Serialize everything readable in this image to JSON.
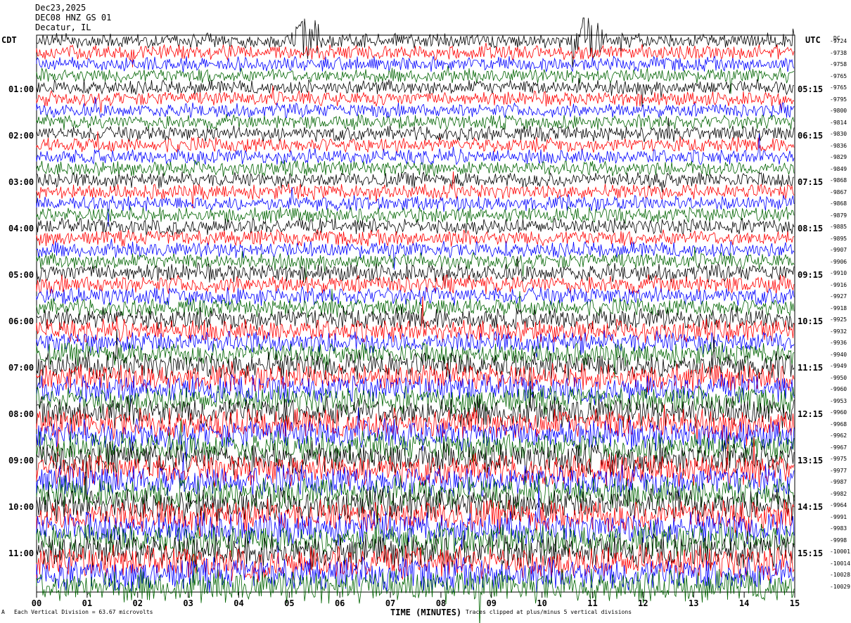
{
  "header": {
    "date": "Dec23,2025",
    "station": "DEC08 HNZ GS 01",
    "location": "Decatur, IL"
  },
  "left_timezone": "CDT",
  "right_timezone": "UTC",
  "dc_header": "DC",
  "footer": {
    "scale_note": "Each Vertical Division = 63.67 microvolts",
    "clip_note": "Traces clipped at plus/minus 5 vertical divisions",
    "corner_mark": "A"
  },
  "chart_data": {
    "type": "line",
    "title": "DEC08 HNZ GS 01",
    "xlabel": "TIME (MINUTES)",
    "ylabel": "",
    "xlim": [
      0,
      15
    ],
    "x_ticks": [
      "00",
      "01",
      "02",
      "03",
      "04",
      "05",
      "06",
      "07",
      "08",
      "09",
      "10",
      "11",
      "12",
      "13",
      "14",
      "15"
    ],
    "left_hour_labels": [
      "01:00",
      "02:00",
      "03:00",
      "04:00",
      "05:00",
      "06:00",
      "07:00",
      "08:00",
      "09:00",
      "10:00",
      "11:00"
    ],
    "right_hour_labels": [
      "05:15",
      "06:15",
      "07:15",
      "08:15",
      "09:15",
      "10:15",
      "11:15",
      "12:15",
      "13:15",
      "14:15",
      "15:15"
    ],
    "trace_colors": [
      "#000000",
      "#ff0000",
      "#0000ff",
      "#006400"
    ],
    "dc_offsets": [
      "-9724",
      "-9738",
      "-9758",
      "-9765",
      "-9765",
      "-9795",
      "-9800",
      "-9814",
      "-9830",
      "-9836",
      "-9829",
      "-9849",
      "-9868",
      "-9867",
      "-9868",
      "-9879",
      "-9885",
      "-9895",
      "-9907",
      "-9906",
      "-9910",
      "-9916",
      "-9927",
      "-9918",
      "-9925",
      "-9932",
      "-9936",
      "-9940",
      "-9949",
      "-9950",
      "-9960",
      "-9953",
      "-9960",
      "-9968",
      "-9962",
      "-9967",
      "-9975",
      "-9977",
      "-9987",
      "-9982",
      "-9964",
      "-9991",
      "-9983",
      "-9998",
      "-10001",
      "-10014",
      "-10028",
      "-10029"
    ],
    "trace_count": 48,
    "noise_profile": {
      "comment": "relative peak amplitude per hour row (0-11), increasing through the day",
      "row_amplitude": [
        1.0,
        1.0,
        1.05,
        1.05,
        1.1,
        1.25,
        1.55,
        1.9,
        2.1,
        2.2,
        2.25,
        2.3
      ]
    },
    "events": [
      {
        "minute": 5.3,
        "row": 0,
        "label": ""
      },
      {
        "minute": 10.9,
        "row": 0,
        "label": ""
      }
    ]
  }
}
